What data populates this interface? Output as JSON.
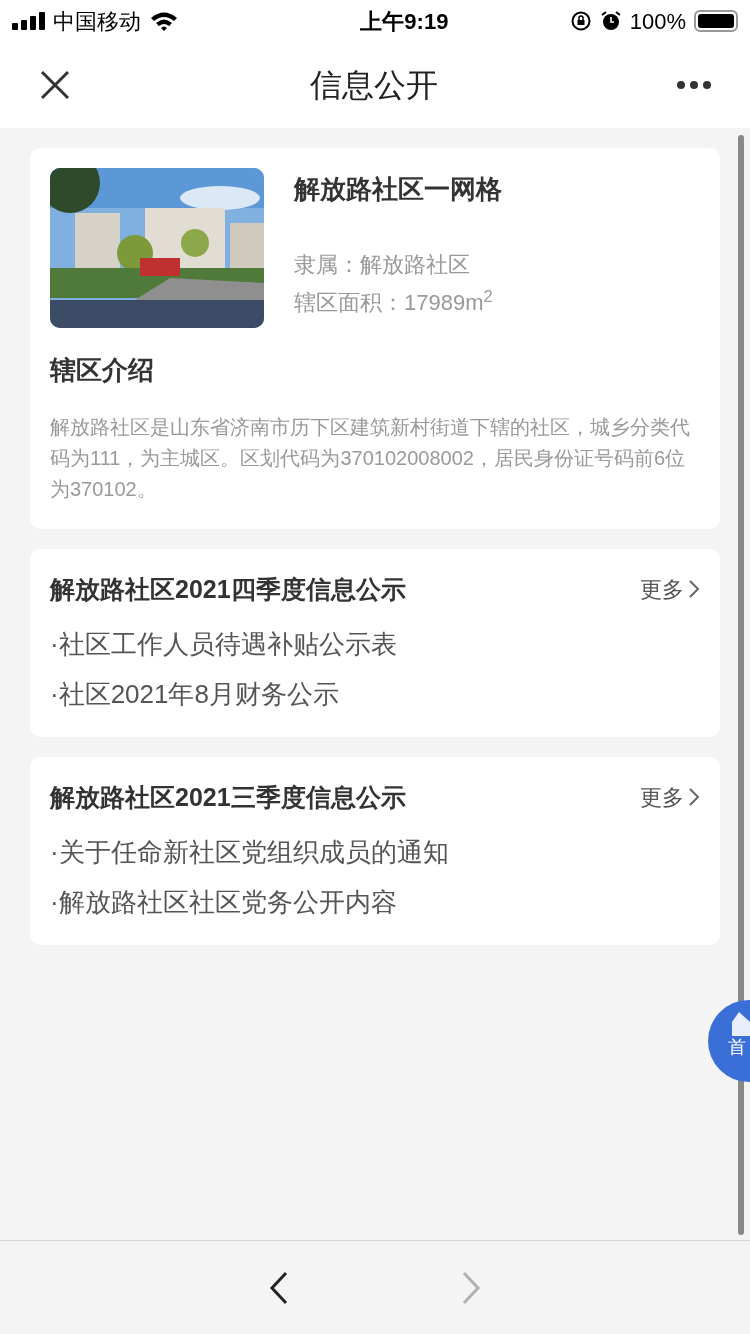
{
  "status_bar": {
    "carrier": "中国移动",
    "time": "上午9:19",
    "battery": "100%"
  },
  "nav_bar": {
    "title": "信息公开"
  },
  "profile": {
    "name": "解放路社区一网格",
    "affiliation": "隶属：解放路社区",
    "area": "辖区面积：17989m$^{2}$",
    "intro_title": "辖区介绍",
    "intro": "解放路社区是山东省济南市历下区建筑新村街道下辖的社区，城乡分类代码为111，为主城区。区划代码为370102008002，居民身份证号码前6位为370102。"
  },
  "sections": [
    {
      "title": "解放路社区2021四季度信息公示",
      "more": "更多",
      "items": [
        "·社区工作人员待遇补贴公示表",
        "·社区2021年8月财务公示"
      ]
    },
    {
      "title": "解放路社区2021三季度信息公示",
      "more": "更多",
      "items": [
        "·关于任命新社区党组织成员的通知",
        "·解放路社区社区党务公开内容"
      ]
    }
  ],
  "home_button": {
    "label": "首"
  },
  "toolbar": {
    "back": {
      "disabled": false
    },
    "forward": {
      "disabled": true
    }
  }
}
